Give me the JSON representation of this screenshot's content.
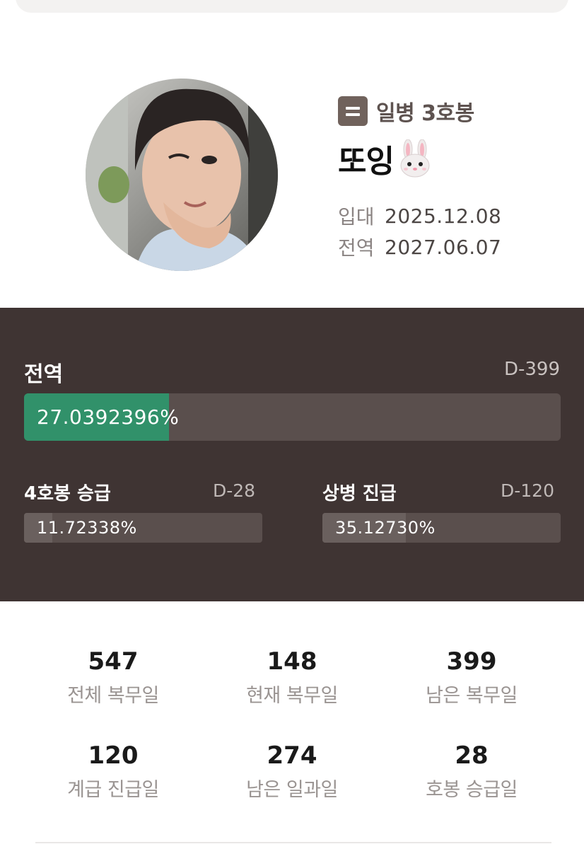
{
  "profile": {
    "rank": "일병 3호봉",
    "name": "또잉",
    "name_emoji": "rabbit-face-icon",
    "enlist_label": "입대",
    "enlist_date": "2025.12.08",
    "discharge_label": "전역",
    "discharge_date": "2027.06.07"
  },
  "progress": {
    "main": {
      "title": "전역",
      "dday": "D-399",
      "percent_text": "27.0392396%",
      "fraction": 0.270392396
    },
    "promotion": {
      "title": "4호봉 승급",
      "dday": "D-28",
      "percent_text": "11.72338%",
      "fraction": 0.1172338
    },
    "rank_up": {
      "title": "상병 진급",
      "dday": "D-120",
      "percent_text": "35.12730%",
      "fraction": 0.351273
    }
  },
  "stats": [
    {
      "value": "547",
      "label": "전체 복무일"
    },
    {
      "value": "148",
      "label": "현재 복무일"
    },
    {
      "value": "399",
      "label": "남은 복무일"
    },
    {
      "value": "120",
      "label": "계급 진급일"
    },
    {
      "value": "274",
      "label": "남은 일과일"
    },
    {
      "value": "28",
      "label": "호봉 승급일"
    }
  ],
  "colors": {
    "panel_bg": "#3f3433",
    "track": "#5a4f4d",
    "main_fill": "#31916a",
    "sub_fill": "#6a605e",
    "rank_badge": "#70625c"
  }
}
